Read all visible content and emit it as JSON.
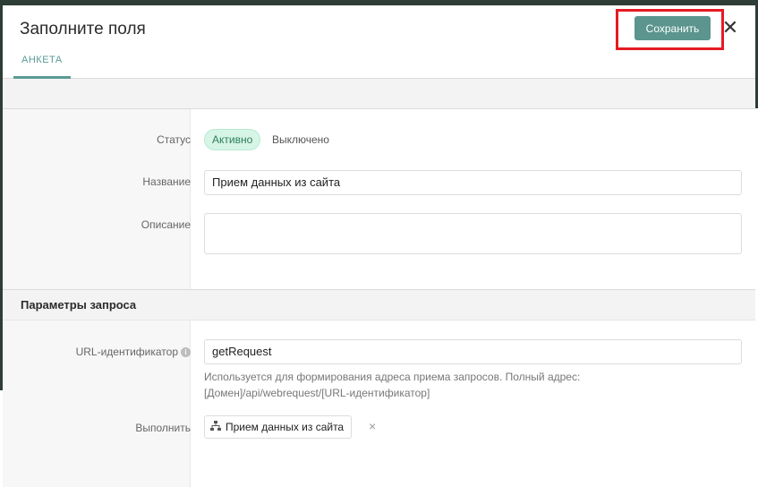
{
  "header": {
    "title": "Заполните поля",
    "tab_label": "АНКЕТА",
    "save_label": "Сохранить",
    "close_symbol": "✕"
  },
  "form": {
    "status": {
      "label": "Статус",
      "active": "Активно",
      "off": "Выключено"
    },
    "name": {
      "label": "Название",
      "value": "Прием данных из сайта"
    },
    "description": {
      "label": "Описание",
      "value": ""
    }
  },
  "request_params": {
    "section_title": "Параметры запроса",
    "url_id": {
      "label": "URL-идентификатор",
      "info_symbol": "i",
      "value": "getRequest",
      "help_line1": "Используется для формирования адреса приема запросов. Полный адрес:",
      "help_line2": "[Домен]/api/webrequest/[URL-идентификатор]"
    },
    "execute": {
      "label": "Выполнить",
      "chip_label": "Прием данных из сайта",
      "chip_icon": "sitemap-icon",
      "remove_symbol": "×"
    }
  },
  "colors": {
    "accent": "#5b958d",
    "highlight": "#e51b24",
    "active_bg": "#d6f5e6"
  }
}
